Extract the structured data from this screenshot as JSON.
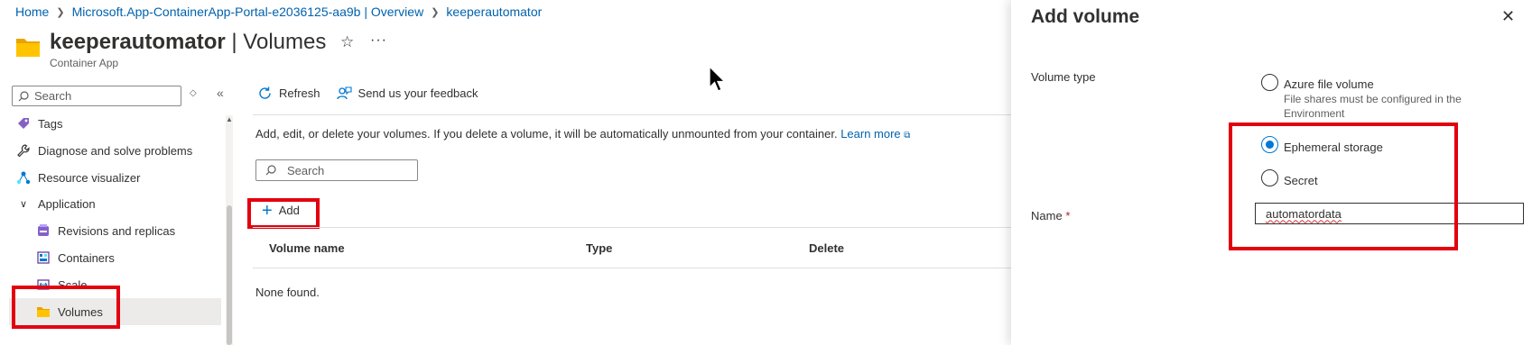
{
  "breadcrumb": {
    "home": "Home",
    "env": "Microsoft.App-ContainerApp-Portal-e2036125-aa9b | Overview",
    "app": "keeperautomator"
  },
  "header": {
    "title_bold": "keeperautomator",
    "title_rest": " | Volumes",
    "subtitle": "Container App"
  },
  "sidebar": {
    "search_placeholder": "Search",
    "items": [
      {
        "label": "Tags"
      },
      {
        "label": "Diagnose and solve problems"
      },
      {
        "label": "Resource visualizer"
      },
      {
        "label": "Application"
      },
      {
        "label": "Revisions and replicas"
      },
      {
        "label": "Containers"
      },
      {
        "label": "Scale"
      },
      {
        "label": "Volumes"
      }
    ]
  },
  "main": {
    "refresh": "Refresh",
    "feedback": "Send us your feedback",
    "description": "Add, edit, or delete your volumes. If you delete a volume, it will be automatically unmounted from your container.",
    "learn_more": "Learn more",
    "search_placeholder": "Search",
    "add": "Add",
    "columns": [
      "Volume name",
      "Type",
      "Delete"
    ],
    "empty": "None found."
  },
  "panel": {
    "title": "Add volume",
    "volume_type_label": "Volume type",
    "options": [
      {
        "label": "Azure file volume",
        "help": "File shares must be configured in the Environment",
        "checked": false
      },
      {
        "label": "Ephemeral storage",
        "checked": true
      },
      {
        "label": "Secret",
        "checked": false
      }
    ],
    "name_label": "Name",
    "required_mark": "*",
    "name_value": "automatordata"
  },
  "colors": {
    "accent": "#0078d4",
    "link": "#0062ad",
    "highlight": "#e3000f"
  }
}
